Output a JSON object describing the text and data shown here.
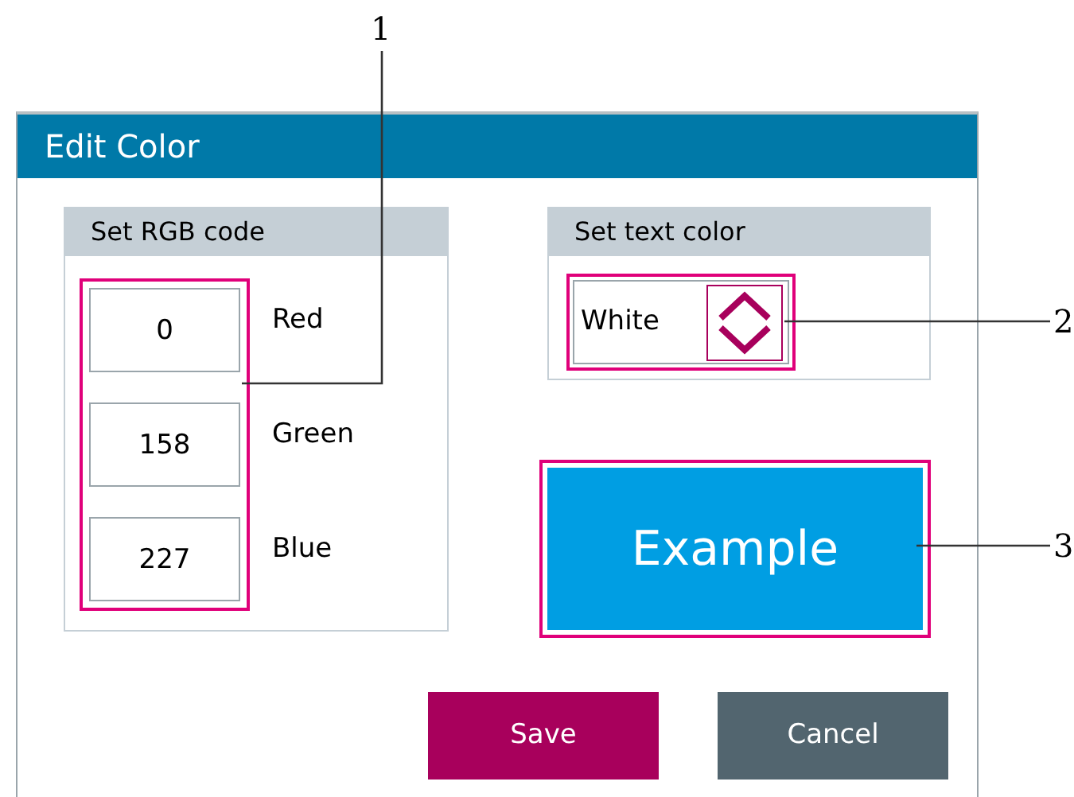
{
  "dialog": {
    "title": "Edit Color"
  },
  "rgb_group": {
    "title": "Set RGB code",
    "fields": [
      {
        "value": "0",
        "label": "Red"
      },
      {
        "value": "158",
        "label": "Green"
      },
      {
        "value": "227",
        "label": "Blue"
      }
    ]
  },
  "text_color_group": {
    "title": "Set text color",
    "value": "White"
  },
  "preview": {
    "label": "Example"
  },
  "buttons": [
    {
      "label": "Save",
      "kind": "primary"
    },
    {
      "label": "Cancel",
      "kind": "secondary"
    }
  ],
  "callouts": [
    {
      "label": "1"
    },
    {
      "label": "2"
    },
    {
      "label": "3"
    }
  ]
}
